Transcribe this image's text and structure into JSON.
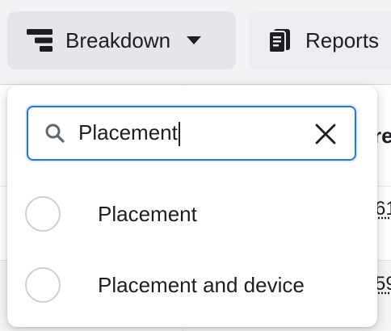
{
  "toolbar": {
    "breakdown_label": "Breakdown",
    "reports_label": "Reports"
  },
  "background_table": {
    "header_partial": "re",
    "row1_partial": "61",
    "row2_partial": "59"
  },
  "dropdown": {
    "search": {
      "value": "Placement"
    },
    "options": [
      {
        "label": "Placement",
        "selected": false
      },
      {
        "label": "Placement and device",
        "selected": false
      }
    ]
  },
  "colors": {
    "accent": "#1877f2",
    "button_bg": "#e4e6eb",
    "text": "#1c1e21",
    "radio_border": "#ccd0d5"
  }
}
